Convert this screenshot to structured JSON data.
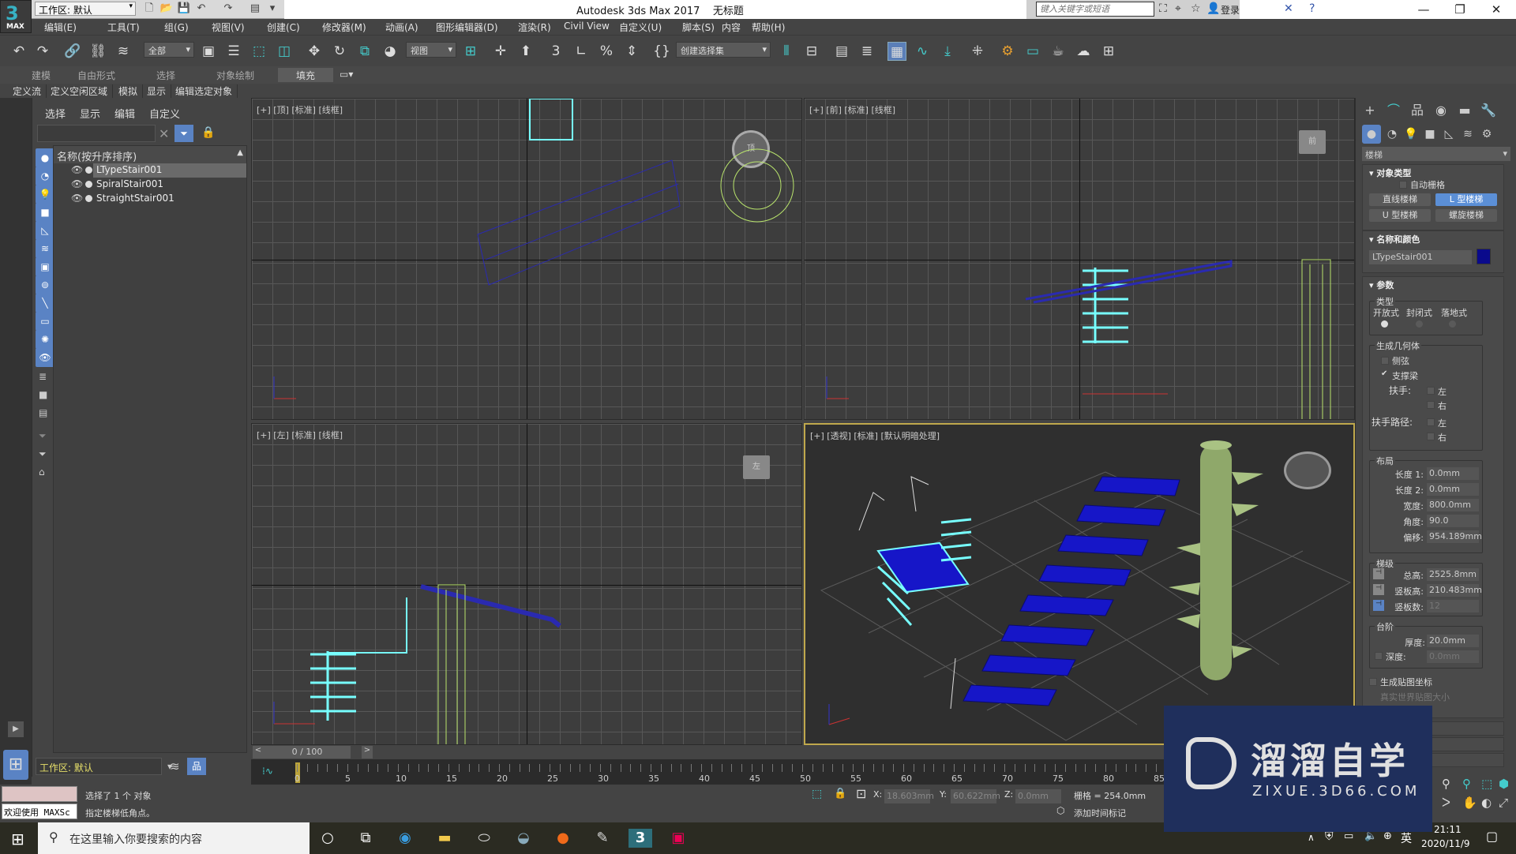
{
  "app": {
    "title": "Autodesk 3ds Max 2017",
    "document": "无标题",
    "logo": "3",
    "logo_sub": "MAX",
    "workspace": "工作区: 默认",
    "search_placeholder": "键入关键字或短语",
    "login": "登录"
  },
  "menu": [
    "编辑(E)",
    "工具(T)",
    "组(G)",
    "视图(V)",
    "创建(C)",
    "修改器(M)",
    "动画(A)",
    "图形编辑器(D)",
    "渲染(R)",
    "Civil View",
    "自定义(U)",
    "脚本(S)",
    "内容",
    "帮助(H)"
  ],
  "toolbar": {
    "selection_filter": "全部",
    "ref_coord": "视图",
    "named_selection": "创建选择集"
  },
  "ribbon": {
    "tabs": [
      "建模",
      "自由形式",
      "选择",
      "对象绘制",
      "填充"
    ],
    "active_tab": "填充",
    "sub_items": [
      "定义流",
      "定义空闲区域",
      "模拟",
      "显示",
      "编辑选定对象"
    ]
  },
  "scene_explorer": {
    "menus": [
      "选择",
      "显示",
      "编辑",
      "自定义"
    ],
    "column_header": "名称(按升序排序)",
    "items": [
      {
        "name": "LTypeStair001",
        "selected": true
      },
      {
        "name": "SpiralStair001",
        "selected": false
      },
      {
        "name": "StraightStair001",
        "selected": false
      }
    ],
    "workspace": "工作区: 默认"
  },
  "viewports": [
    {
      "label": "[+] [顶] [标准] [线框]",
      "gizmo": "顶"
    },
    {
      "label": "[+] [前] [标准] [线框]",
      "gizmo": "前"
    },
    {
      "label": "[+] [左] [标准] [线框]",
      "gizmo": "左"
    },
    {
      "label": "[+] [透视] [标准] [默认明暗处理]",
      "active": true
    }
  ],
  "command_panel": {
    "category": "楼梯",
    "object_type": {
      "title": "对象类型",
      "autogrid": "自动栅格",
      "buttons": [
        "直线楼梯",
        "L 型楼梯",
        "U 型楼梯",
        "螺旋楼梯"
      ],
      "active": "L 型楼梯"
    },
    "name_color": {
      "title": "名称和颜色",
      "name": "LTypeStair001",
      "color": "#0a0a8c"
    },
    "params": {
      "title": "参数",
      "type_group": "类型",
      "types": [
        "开放式",
        "封闭式",
        "落地式"
      ],
      "type_selected": "开放式",
      "geometry_group": "生成几何体",
      "stringers": "侧弦",
      "stringers_checked": false,
      "carriage": "支撑梁",
      "carriage_checked": true,
      "handrail": "扶手:",
      "rail_path": "扶手路径:",
      "left": "左",
      "right": "右",
      "layout_group": "布局",
      "layout": [
        {
          "label": "长度 1:",
          "value": "0.0mm"
        },
        {
          "label": "长度 2:",
          "value": "0.0mm"
        },
        {
          "label": "宽度:",
          "value": "800.0mm"
        },
        {
          "label": "角度:",
          "value": "90.0"
        },
        {
          "label": "偏移:",
          "value": "954.189mm"
        }
      ],
      "risers_group": "梯级",
      "risers": [
        {
          "label": "总高:",
          "value": "2525.8mm"
        },
        {
          "label": "竖板高:",
          "value": "210.483mm"
        },
        {
          "label": "竖板数:",
          "value": "12"
        }
      ],
      "steps_group": "台阶",
      "thickness_label": "厚度:",
      "thickness": "20.0mm",
      "depth_label": "深度:",
      "depth": "0.0mm",
      "gen_mapping": "生成贴图坐标",
      "real_world": "真实世界贴图大小"
    }
  },
  "timeline": {
    "frame": "0 / 100",
    "ticks": [
      "0",
      "5",
      "10",
      "15",
      "20",
      "25",
      "30",
      "35",
      "40",
      "45",
      "50",
      "55",
      "60",
      "65",
      "70",
      "75",
      "80",
      "85"
    ]
  },
  "status": {
    "maxscript": "欢迎使用 MAXSc",
    "line1": "选择了 1 个 对象",
    "line2": "指定楼梯低角点。",
    "x": "18.603mm",
    "y": "60.622mm",
    "z": "0.0mm",
    "grid": "栅格 = 254.0mm",
    "add_time_tag": "添加时间标记"
  },
  "taskbar": {
    "search": "在这里输入你要搜索的内容",
    "time": "21:11",
    "date": "2020/11/9",
    "ime": "英"
  },
  "watermark": {
    "title": "溜溜自学",
    "url": "ZIXUE.3D66.COM"
  }
}
